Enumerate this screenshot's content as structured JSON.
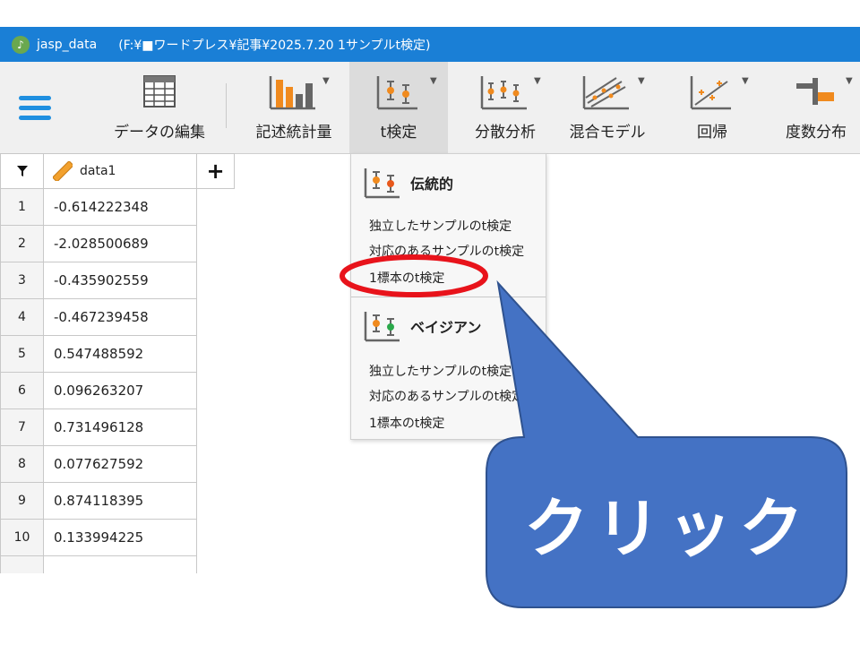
{
  "window": {
    "app_name": "jasp_data",
    "file_path": "(F:¥■ワードプレス¥記事¥2025.7.20 1サンプルt検定)"
  },
  "toolbar": {
    "items": [
      {
        "label": "データの編集",
        "icon": "table-icon"
      },
      {
        "label": "記述統計量",
        "icon": "bar-chart-icon"
      },
      {
        "label": "t検定",
        "icon": "ttest-icon"
      },
      {
        "label": "分散分析",
        "icon": "anova-icon"
      },
      {
        "label": "混合モデル",
        "icon": "mixed-model-icon"
      },
      {
        "label": "回帰",
        "icon": "regression-icon"
      },
      {
        "label": "度数分布",
        "icon": "frequency-icon"
      }
    ]
  },
  "grid": {
    "column_name": "data1",
    "add_column_symbol": "+",
    "rows": [
      {
        "n": "1",
        "value": "-0.614222348"
      },
      {
        "n": "2",
        "value": "-2.028500689"
      },
      {
        "n": "3",
        "value": "-0.435902559"
      },
      {
        "n": "4",
        "value": "-0.467239458"
      },
      {
        "n": "5",
        "value": "0.547488592"
      },
      {
        "n": "6",
        "value": "0.096263207"
      },
      {
        "n": "7",
        "value": "0.731496128"
      },
      {
        "n": "8",
        "value": "0.077627592"
      },
      {
        "n": "9",
        "value": "0.874118395"
      },
      {
        "n": "10",
        "value": "0.133994225"
      }
    ]
  },
  "menu": {
    "classical": {
      "heading": "伝統的",
      "items": [
        "独立したサンプルのt検定",
        "対応のあるサンプルのt検定",
        "1標本のt検定"
      ]
    },
    "bayesian": {
      "heading": "ベイジアン",
      "items": [
        "独立したサンプルのt検定",
        "対応のあるサンプルのt検定",
        "1標本のt検定"
      ]
    }
  },
  "annotation": {
    "callout_text": "クリック",
    "callout_color": "#4472c4",
    "highlight_color": "#e8131b"
  }
}
